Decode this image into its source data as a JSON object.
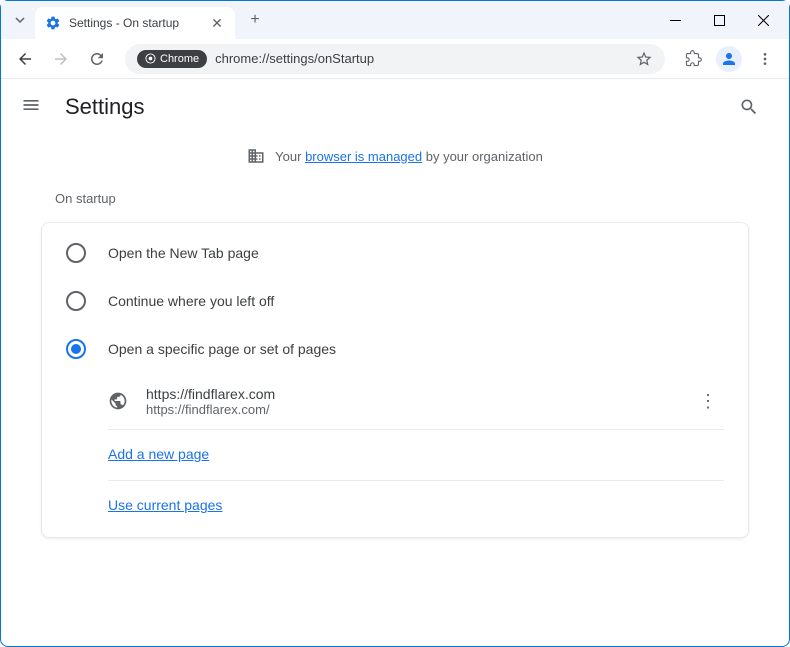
{
  "titlebar": {
    "tab_title": "Settings - On startup"
  },
  "toolbar": {
    "chip_label": "Chrome",
    "url": "chrome://settings/onStartup"
  },
  "header": {
    "title": "Settings"
  },
  "managed": {
    "prefix": "Your ",
    "link": "browser is managed",
    "suffix": " by your organization"
  },
  "section": {
    "title": "On startup",
    "options": [
      {
        "label": "Open the New Tab page",
        "selected": false
      },
      {
        "label": "Continue where you left off",
        "selected": false
      },
      {
        "label": "Open a specific page or set of pages",
        "selected": true
      }
    ],
    "pages": [
      {
        "title": "https://findflarex.com",
        "url": "https://findflarex.com/"
      }
    ],
    "add_link": "Add a new page",
    "use_current_link": "Use current pages"
  }
}
